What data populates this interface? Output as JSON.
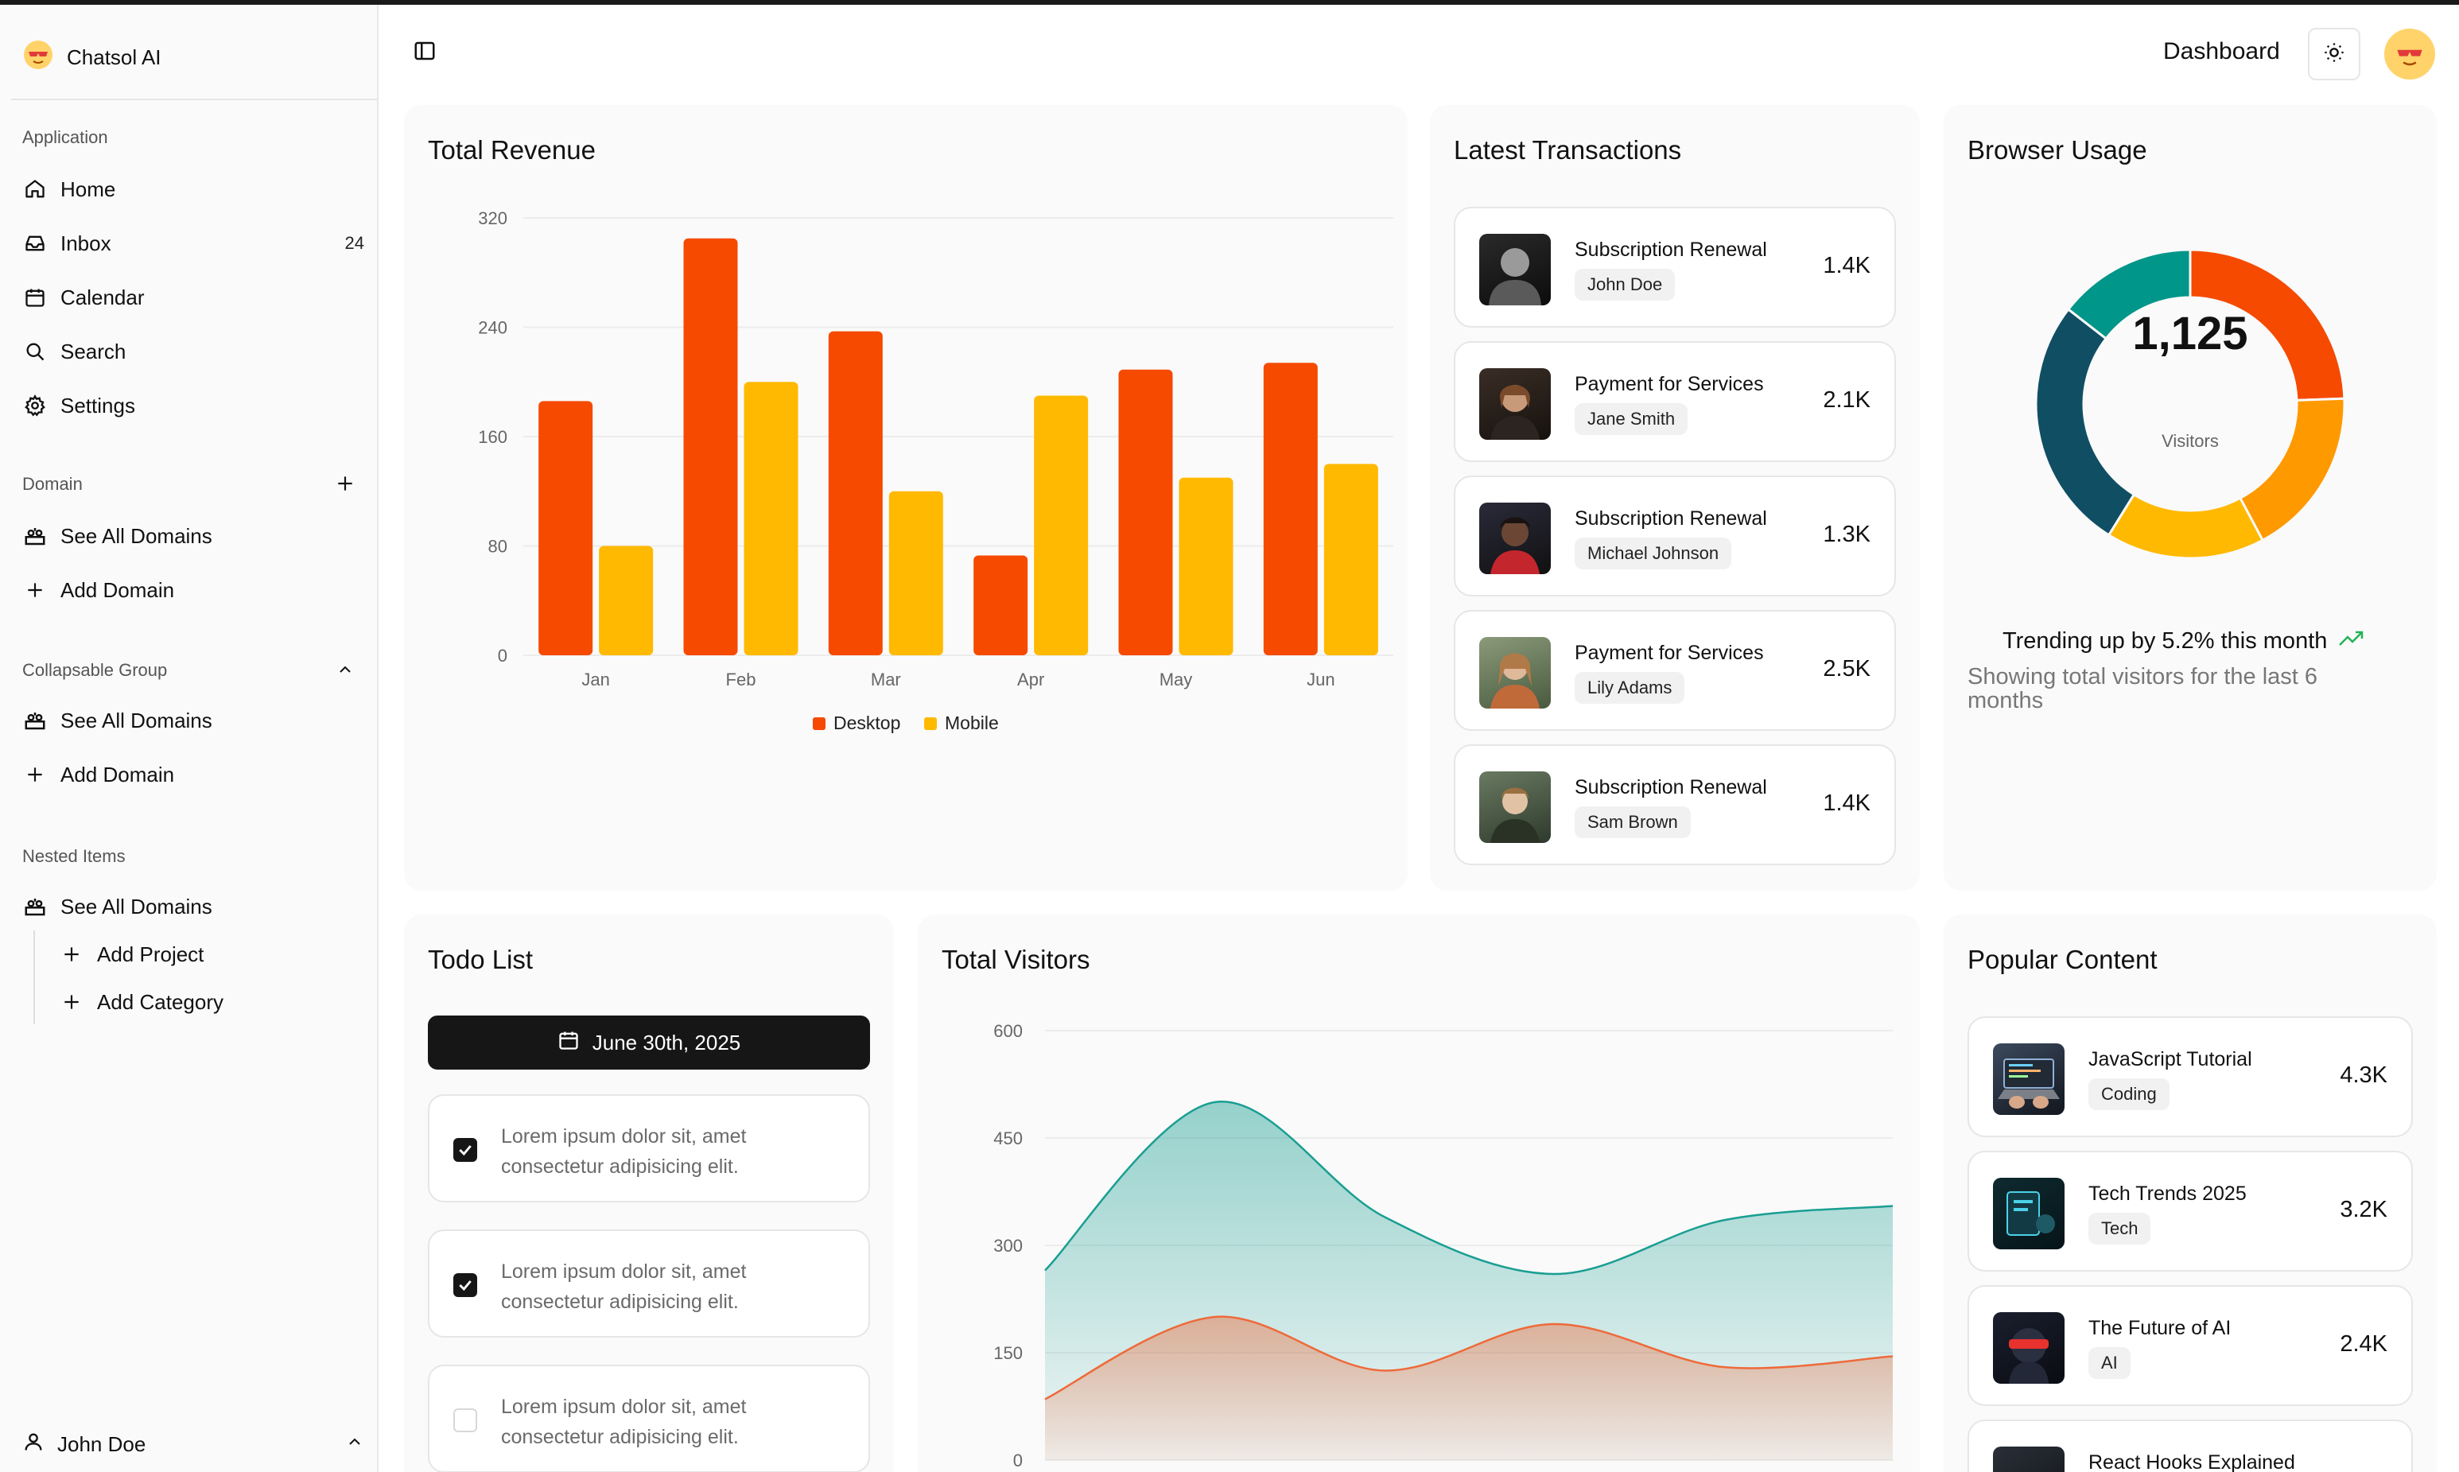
{
  "app": {
    "name": "Chatsol AI"
  },
  "header": {
    "title": "Dashboard"
  },
  "sidebar": {
    "application": {
      "label": "Application",
      "items": [
        {
          "label": "Home",
          "icon": "home-icon"
        },
        {
          "label": "Inbox",
          "icon": "inbox-icon",
          "count": "24"
        },
        {
          "label": "Calendar",
          "icon": "calendar-icon"
        },
        {
          "label": "Search",
          "icon": "search-icon"
        },
        {
          "label": "Settings",
          "icon": "gear-icon"
        }
      ]
    },
    "domain": {
      "label": "Domain",
      "items": [
        {
          "label": "See All Domains",
          "icon": "domains-icon"
        },
        {
          "label": "Add Domain",
          "icon": "plus-icon"
        }
      ]
    },
    "collapsable": {
      "label": "Collapsable Group",
      "items": [
        {
          "label": "See All Domains",
          "icon": "domains-icon"
        },
        {
          "label": "Add Domain",
          "icon": "plus-icon"
        }
      ]
    },
    "nested": {
      "label": "Nested Items",
      "items": [
        {
          "label": "See All Domains",
          "icon": "domains-icon"
        },
        {
          "label": "Add Project",
          "icon": "plus-icon"
        },
        {
          "label": "Add Category",
          "icon": "plus-icon"
        }
      ]
    },
    "user": {
      "name": "John Doe"
    }
  },
  "revenue": {
    "title": "Total Revenue",
    "legend": [
      "Desktop",
      "Mobile"
    ],
    "ticks": [
      "320",
      "240",
      "160",
      "80",
      "0"
    ],
    "colors": {
      "desktop": "#f54a00",
      "mobile": "#ffb900"
    }
  },
  "transactions": {
    "title": "Latest Transactions",
    "items": [
      {
        "title": "Subscription Renewal",
        "name": "John Doe",
        "amount": "1.4K"
      },
      {
        "title": "Payment for Services",
        "name": "Jane Smith",
        "amount": "2.1K"
      },
      {
        "title": "Subscription Renewal",
        "name": "Michael Johnson",
        "amount": "1.3K"
      },
      {
        "title": "Payment for Services",
        "name": "Lily Adams",
        "amount": "2.5K"
      },
      {
        "title": "Subscription Renewal",
        "name": "Sam Brown",
        "amount": "1.4K"
      }
    ]
  },
  "browser": {
    "title": "Browser Usage",
    "total": "1,125",
    "total_label": "Visitors",
    "trend": "Trending up by 5.2% this month",
    "note": "Showing total visitors for the last 6 months",
    "colors": [
      "#f54a00",
      "#ff9900",
      "#ffb900",
      "#104e64",
      "#009689"
    ]
  },
  "todo": {
    "title": "Todo List",
    "date": "June 30th, 2025",
    "items": [
      {
        "text": "Lorem ipsum dolor sit, amet consectetur adipisicing elit.",
        "checked": true
      },
      {
        "text": "Lorem ipsum dolor sit, amet consectetur adipisicing elit.",
        "checked": true
      },
      {
        "text": "Lorem ipsum dolor sit, amet consectetur adipisicing elit.",
        "checked": false
      }
    ]
  },
  "visitors": {
    "title": "Total Visitors",
    "ticks": [
      "600",
      "450",
      "300",
      "150",
      "0"
    ],
    "colors": {
      "teal": "#1a9e92",
      "orange": "#ee6a3a"
    }
  },
  "popular": {
    "title": "Popular Content",
    "items": [
      {
        "title": "JavaScript Tutorial",
        "tag": "Coding",
        "count": "4.3K"
      },
      {
        "title": "Tech Trends 2025",
        "tag": "Tech",
        "count": "3.2K"
      },
      {
        "title": "The Future of AI",
        "tag": "AI",
        "count": "2.4K"
      },
      {
        "title": "React Hooks Explained"
      }
    ]
  },
  "chart_data": [
    {
      "type": "bar",
      "title": "Total Revenue",
      "categories": [
        "Jan",
        "Feb",
        "Mar",
        "Apr",
        "May",
        "Jun"
      ],
      "series": [
        {
          "name": "Desktop",
          "values": [
            186,
            305,
            237,
            73,
            209,
            214
          ]
        },
        {
          "name": "Mobile",
          "values": [
            80,
            200,
            120,
            190,
            130,
            140
          ]
        }
      ],
      "ylim": [
        0,
        320
      ],
      "legend": "bottom",
      "grid": true
    },
    {
      "type": "pie",
      "title": "Browser Usage",
      "labels": [
        "",
        "",
        "",
        "",
        ""
      ],
      "values": [
        275,
        200,
        187,
        300,
        163
      ],
      "donut": true
    },
    {
      "type": "area",
      "title": "Total Visitors",
      "x": [
        0,
        1,
        2,
        3,
        4,
        5
      ],
      "series": [
        {
          "values": [
            265,
            500,
            340,
            260,
            335,
            355
          ]
        },
        {
          "values": [
            85,
            200,
            125,
            190,
            130,
            145
          ]
        }
      ],
      "ylim": [
        0,
        600
      ],
      "grid": true
    }
  ]
}
